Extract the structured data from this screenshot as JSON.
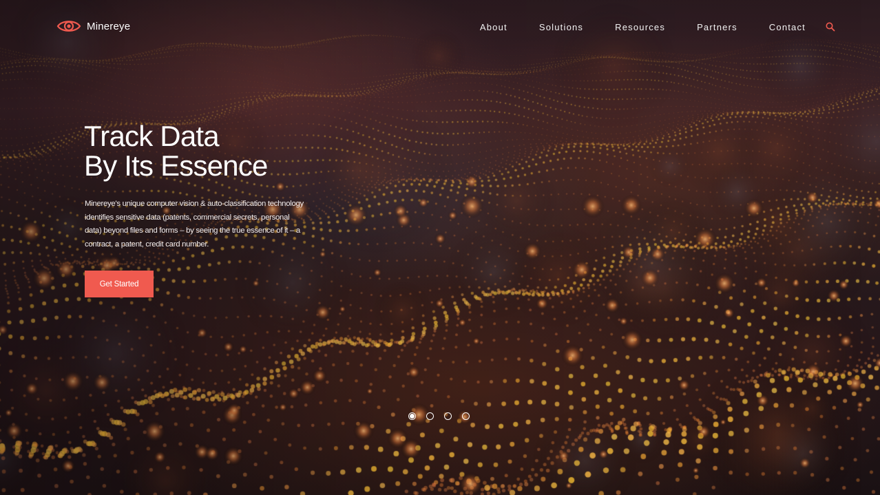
{
  "brand": {
    "name": "Minereye",
    "logo_icon": "eye-icon",
    "accent_color": "#f05a4f"
  },
  "nav": {
    "items": [
      {
        "label": "About"
      },
      {
        "label": "Solutions"
      },
      {
        "label": "Resources"
      },
      {
        "label": "Partners"
      },
      {
        "label": "Contact"
      }
    ],
    "search_icon": "search-icon"
  },
  "hero": {
    "headline_line1": "Track Data",
    "headline_line2": "By Its Essence",
    "description": "Minereye's unique computer vision & auto-classification technology identifies sensitive data (patents, commercial secrets, personal data) beyond files and forms – by seeing the true essence of it – a contract, a patent, credit card number.",
    "cta_label": "Get Started",
    "cta_color": "#f05a4f"
  },
  "carousel": {
    "slide_count": 4,
    "active_slide": 1
  }
}
